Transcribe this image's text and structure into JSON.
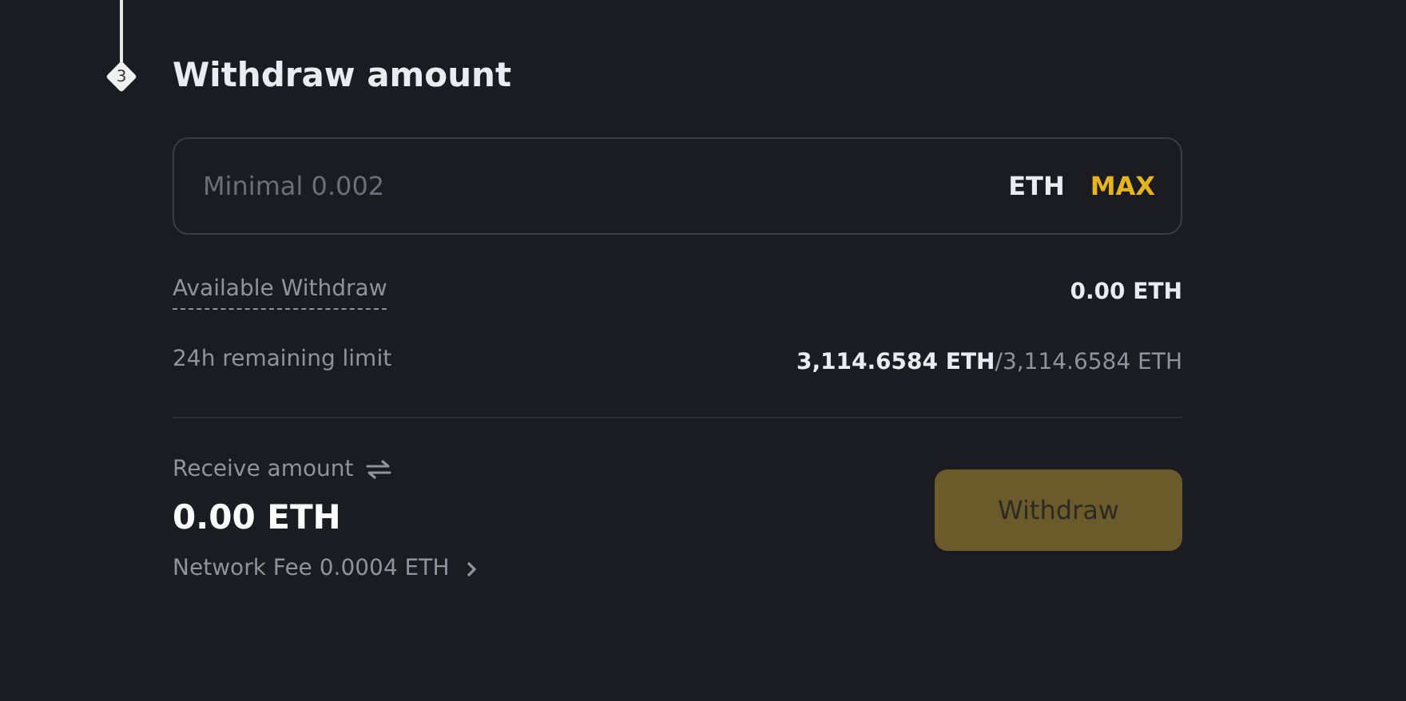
{
  "step": {
    "number": "3",
    "title": "Withdraw amount"
  },
  "amount_field": {
    "placeholder": "Minimal 0.002",
    "currency": "ETH",
    "max_label": "MAX"
  },
  "info_rows": [
    {
      "label": "Available Withdraw",
      "underlined": true,
      "value": "0.00 ETH"
    },
    {
      "label": "24h remaining limit",
      "underlined": false,
      "value": "3,114.6584 ETH",
      "separator": "/",
      "value_secondary": "3,114.6584 ETH"
    }
  ],
  "receive": {
    "label": "Receive amount",
    "amount": "0.00 ETH",
    "fee": "Network Fee 0.0004 ETH"
  },
  "withdraw_button": {
    "label": "Withdraw",
    "disabled": true
  }
}
